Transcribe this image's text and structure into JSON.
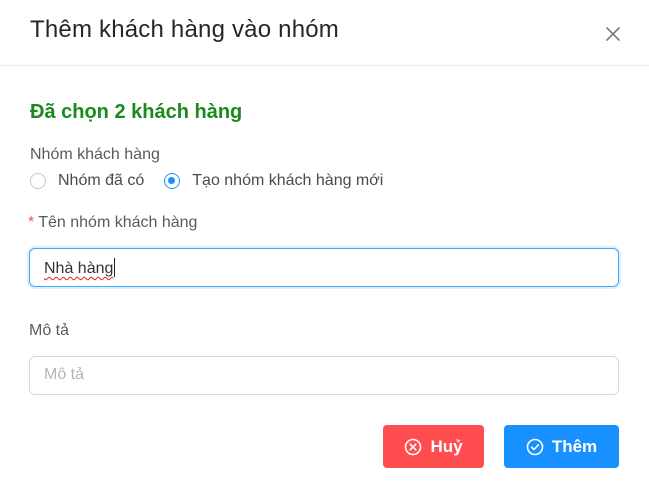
{
  "dialog": {
    "title": "Thêm khách hàng vào nhóm",
    "close_icon": "close-icon"
  },
  "selection": {
    "summary": "Đã chọn 2 khách hàng"
  },
  "group_type": {
    "label": "Nhóm khách hàng",
    "options": [
      {
        "label": "Nhóm đã có",
        "checked": false
      },
      {
        "label": "Tạo nhóm khách hàng mới",
        "checked": true
      }
    ]
  },
  "group_name": {
    "required_mark": "*",
    "label": "Tên nhóm khách hàng",
    "value": "Nhà hàng"
  },
  "description": {
    "label": "Mô tả",
    "placeholder": "Mô tả",
    "value": ""
  },
  "actions": {
    "cancel_label": "Huỷ",
    "cancel_icon": "close-circle-icon",
    "add_label": "Thêm",
    "add_icon": "check-circle-icon"
  },
  "colors": {
    "success_text": "#1a8a1a",
    "primary": "#1890ff",
    "danger": "#ff4d4f"
  }
}
